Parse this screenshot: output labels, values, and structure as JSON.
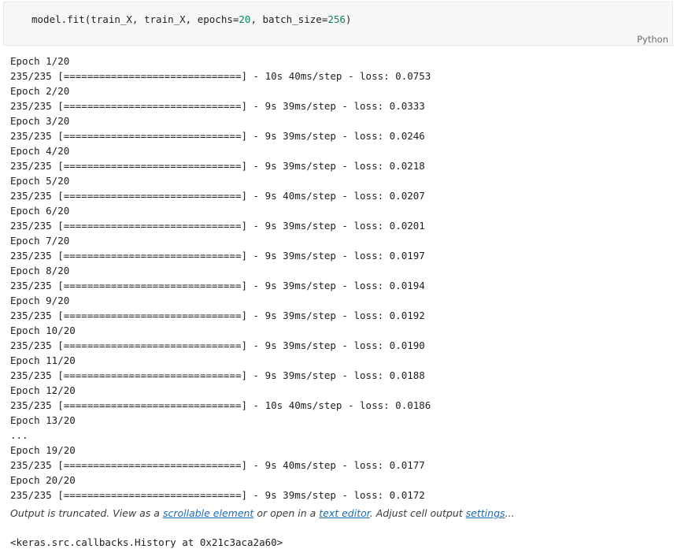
{
  "code_cell": {
    "code_parts": {
      "p1": "model.fit(train_X, train_X, epochs=",
      "n1": "20",
      "p2": ", batch_size=",
      "n2": "256",
      "p3": ")"
    },
    "language": "Python"
  },
  "output": {
    "lines": [
      "Epoch 1/20",
      "235/235 [==============================] - 10s 40ms/step - loss: 0.0753",
      "Epoch 2/20",
      "235/235 [==============================] - 9s 39ms/step - loss: 0.0333",
      "Epoch 3/20",
      "235/235 [==============================] - 9s 39ms/step - loss: 0.0246",
      "Epoch 4/20",
      "235/235 [==============================] - 9s 39ms/step - loss: 0.0218",
      "Epoch 5/20",
      "235/235 [==============================] - 9s 40ms/step - loss: 0.0207",
      "Epoch 6/20",
      "235/235 [==============================] - 9s 39ms/step - loss: 0.0201",
      "Epoch 7/20",
      "235/235 [==============================] - 9s 39ms/step - loss: 0.0197",
      "Epoch 8/20",
      "235/235 [==============================] - 9s 39ms/step - loss: 0.0194",
      "Epoch 9/20",
      "235/235 [==============================] - 9s 39ms/step - loss: 0.0192",
      "Epoch 10/20",
      "235/235 [==============================] - 9s 39ms/step - loss: 0.0190",
      "Epoch 11/20",
      "235/235 [==============================] - 9s 39ms/step - loss: 0.0188",
      "Epoch 12/20",
      "235/235 [==============================] - 10s 40ms/step - loss: 0.0186",
      "Epoch 13/20",
      "...",
      "Epoch 19/20",
      "235/235 [==============================] - 9s 40ms/step - loss: 0.0177",
      "Epoch 20/20",
      "235/235 [==============================] - 9s 39ms/step - loss: 0.0172"
    ],
    "truncation": {
      "t1": "Output is truncated. View as a ",
      "link_scrollable": "scrollable element",
      "t2": " or open in a ",
      "link_text_editor": "text editor",
      "t3": ". Adjust cell output ",
      "link_settings": "settings",
      "t4": "..."
    },
    "result": "<keras.src.callbacks.History at 0x21c3aca2a60>"
  }
}
